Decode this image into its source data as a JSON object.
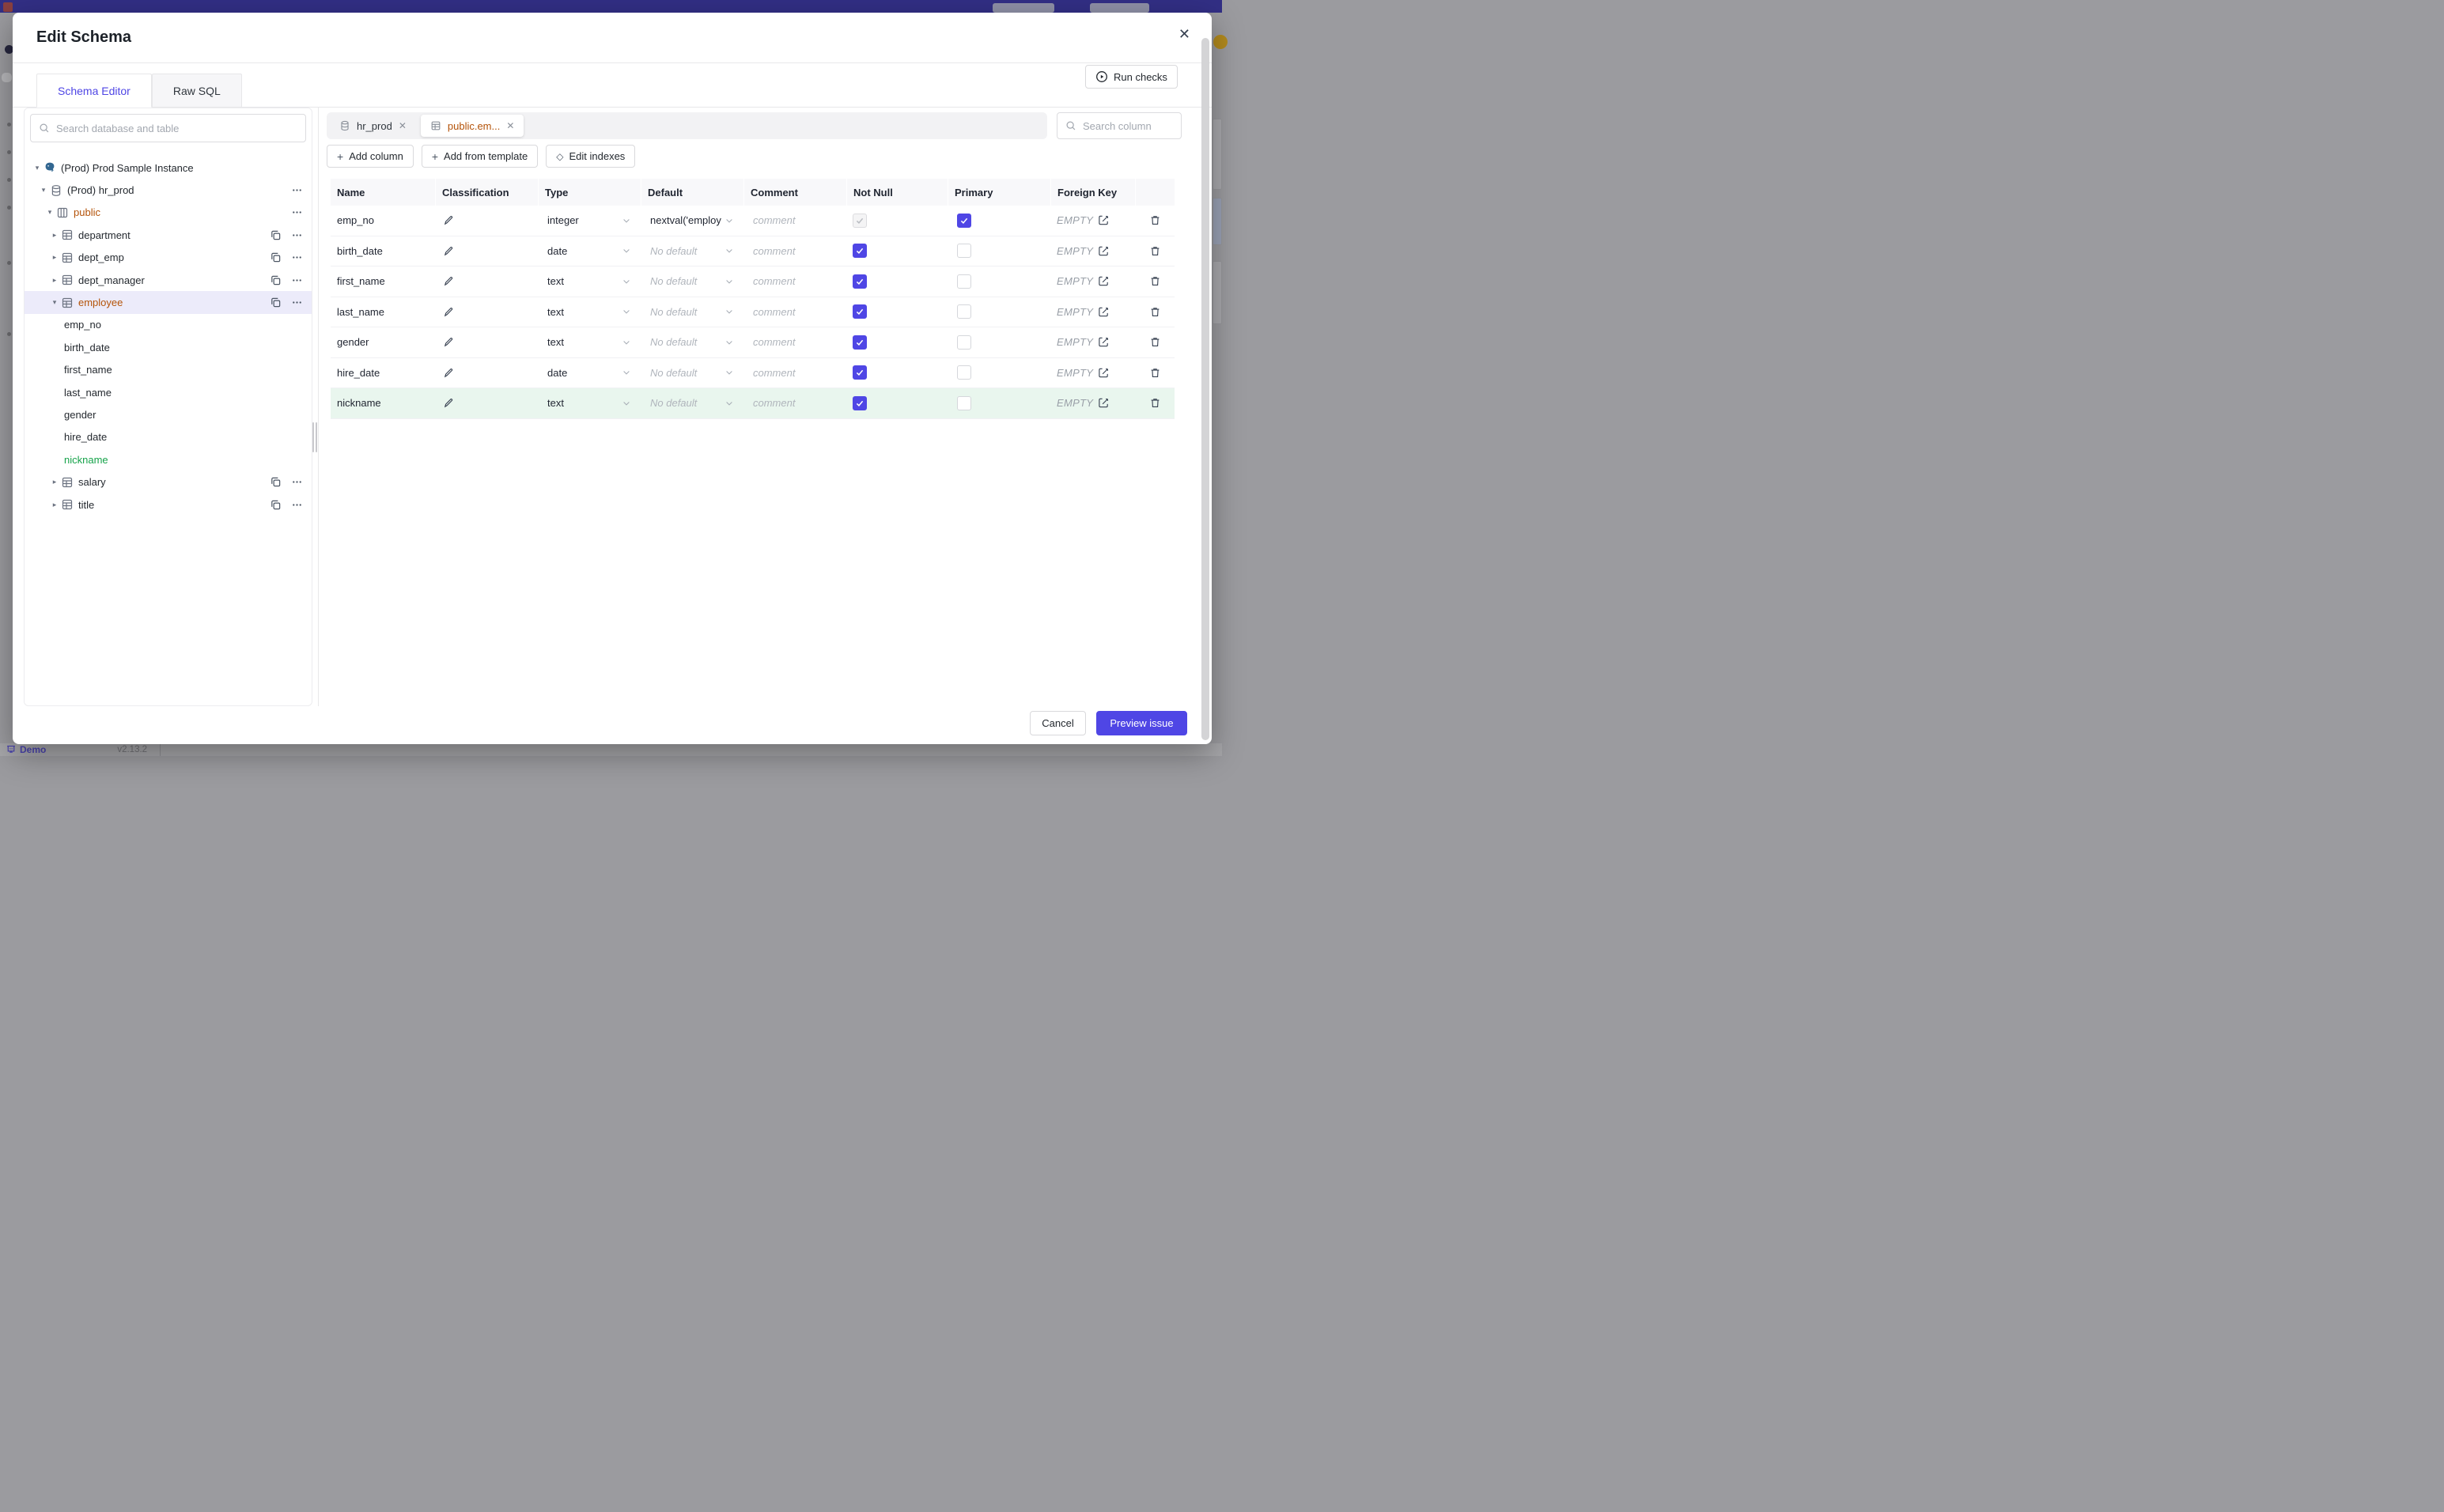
{
  "background": {
    "bottom_left_label": "Demo",
    "version": "v2.13.2"
  },
  "modal": {
    "title": "Edit Schema",
    "close_icon": "✕",
    "tabs": [
      {
        "label": "Schema Editor",
        "active": true
      },
      {
        "label": "Raw SQL",
        "active": false
      }
    ],
    "run_checks_label": "Run checks"
  },
  "sidebar": {
    "search_placeholder": "Search database and table",
    "tree": [
      {
        "kind": "instance",
        "label": "(Prod) Prod Sample Instance",
        "expanded": true,
        "actions": []
      },
      {
        "kind": "database",
        "label": "(Prod) hr_prod",
        "expanded": true,
        "actions": [
          "more"
        ]
      },
      {
        "kind": "schema",
        "label": "public",
        "expanded": true,
        "modified": true,
        "actions": [
          "more"
        ]
      },
      {
        "kind": "table",
        "label": "department",
        "expanded": false,
        "actions": [
          "copy",
          "more"
        ]
      },
      {
        "kind": "table",
        "label": "dept_emp",
        "expanded": false,
        "actions": [
          "copy",
          "more"
        ]
      },
      {
        "kind": "table",
        "label": "dept_manager",
        "expanded": false,
        "actions": [
          "copy",
          "more"
        ]
      },
      {
        "kind": "table",
        "label": "employee",
        "expanded": true,
        "selected": true,
        "modified": true,
        "actions": [
          "copy",
          "more"
        ]
      },
      {
        "kind": "column",
        "label": "emp_no"
      },
      {
        "kind": "column",
        "label": "birth_date"
      },
      {
        "kind": "column",
        "label": "first_name"
      },
      {
        "kind": "column",
        "label": "last_name"
      },
      {
        "kind": "column",
        "label": "gender"
      },
      {
        "kind": "column",
        "label": "hire_date"
      },
      {
        "kind": "column",
        "label": "nickname",
        "new": true
      },
      {
        "kind": "table",
        "label": "salary",
        "expanded": false,
        "actions": [
          "copy",
          "more"
        ]
      },
      {
        "kind": "table",
        "label": "title",
        "expanded": false,
        "actions": [
          "copy",
          "more"
        ]
      }
    ]
  },
  "main": {
    "editor_tabs": [
      {
        "label": "hr_prod",
        "kind": "database",
        "active": false
      },
      {
        "label": "public.em...",
        "kind": "table",
        "active": true,
        "modified": true
      }
    ],
    "column_search_placeholder": "Search column",
    "actions": [
      {
        "icon": "plus",
        "label": "Add column"
      },
      {
        "icon": "plus",
        "label": "Add from template"
      },
      {
        "icon": "diamond",
        "label": "Edit indexes"
      }
    ],
    "table": {
      "headers": [
        "Name",
        "Classification",
        "Type",
        "Default",
        "Comment",
        "Not Null",
        "Primary",
        "Foreign Key"
      ],
      "no_default_placeholder": "No default",
      "comment_placeholder": "comment",
      "foreign_key_empty": "EMPTY",
      "rows": [
        {
          "name": "emp_no",
          "type": "integer",
          "default": "nextval('employ",
          "has_default": true,
          "not_null": true,
          "not_null_disabled": true,
          "primary": true,
          "new": false
        },
        {
          "name": "birth_date",
          "type": "date",
          "default": "",
          "has_default": false,
          "not_null": true,
          "not_null_disabled": false,
          "primary": false,
          "new": false
        },
        {
          "name": "first_name",
          "type": "text",
          "default": "",
          "has_default": false,
          "not_null": true,
          "not_null_disabled": false,
          "primary": false,
          "new": false
        },
        {
          "name": "last_name",
          "type": "text",
          "default": "",
          "has_default": false,
          "not_null": true,
          "not_null_disabled": false,
          "primary": false,
          "new": false
        },
        {
          "name": "gender",
          "type": "text",
          "default": "",
          "has_default": false,
          "not_null": true,
          "not_null_disabled": false,
          "primary": false,
          "new": false
        },
        {
          "name": "hire_date",
          "type": "date",
          "default": "",
          "has_default": false,
          "not_null": true,
          "not_null_disabled": false,
          "primary": false,
          "new": false
        },
        {
          "name": "nickname",
          "type": "text",
          "default": "",
          "has_default": false,
          "not_null": true,
          "not_null_disabled": false,
          "primary": false,
          "new": true
        }
      ]
    }
  },
  "footer": {
    "cancel_label": "Cancel",
    "primary_label": "Preview issue"
  },
  "colors": {
    "accent": "#4f46e5",
    "modified_amber": "#b45309",
    "new_green": "#16a34a",
    "new_row_bg": "#e9f6ee",
    "selected_row_bg": "#ecebfa",
    "topbar": "#322f85"
  }
}
